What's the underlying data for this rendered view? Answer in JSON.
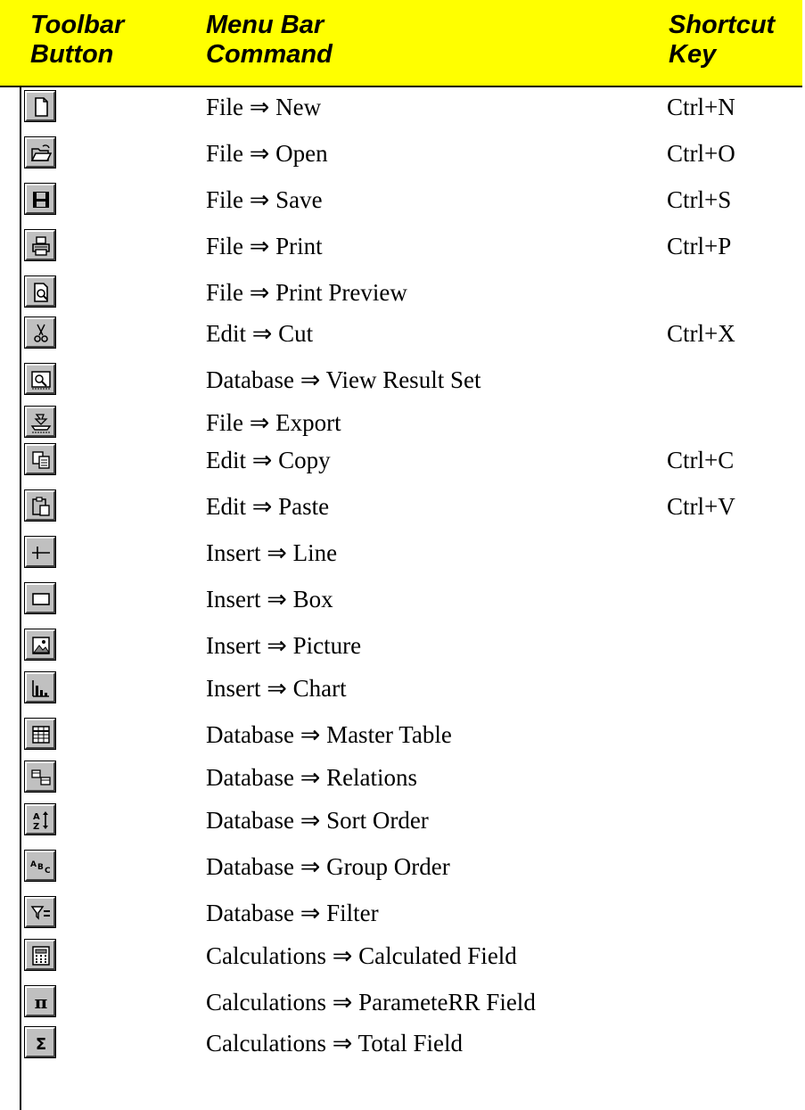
{
  "header": {
    "col1": "Toolbar\nButton",
    "col2": "Menu Bar\nCommand",
    "col3": "Shortcut\nKey"
  },
  "rows": [
    {
      "icon": "new-document-icon",
      "command": "File ⇒ New",
      "shortcut": "Ctrl+N"
    },
    {
      "icon": "open-folder-icon",
      "command": "File ⇒ Open",
      "shortcut": "Ctrl+O"
    },
    {
      "icon": "save-disk-icon",
      "command": "File ⇒ Save",
      "shortcut": "Ctrl+S"
    },
    {
      "icon": "printer-icon",
      "command": "File ⇒ Print",
      "shortcut": "Ctrl+P"
    },
    {
      "icon": "print-preview-icon",
      "command": "File ⇒ Print Preview",
      "shortcut": ""
    },
    {
      "icon": "scissors-icon",
      "command": "Edit ⇒ Cut",
      "shortcut": "Ctrl+X"
    },
    {
      "icon": "view-result-set-icon",
      "command": "Database ⇒ View Result Set",
      "shortcut": ""
    },
    {
      "icon": "export-icon",
      "command": "File ⇒ Export",
      "shortcut": ""
    },
    {
      "icon": "copy-icon",
      "command": "Edit ⇒ Copy",
      "shortcut": "Ctrl+C"
    },
    {
      "icon": "paste-clipboard-icon",
      "command": "Edit ⇒ Paste",
      "shortcut": "Ctrl+V"
    },
    {
      "icon": "line-icon",
      "command": "Insert ⇒ Line",
      "shortcut": ""
    },
    {
      "icon": "box-icon",
      "command": "Insert ⇒ Box",
      "shortcut": ""
    },
    {
      "icon": "picture-icon",
      "command": "Insert ⇒ Picture",
      "shortcut": ""
    },
    {
      "icon": "chart-icon",
      "command": "Insert ⇒ Chart",
      "shortcut": ""
    },
    {
      "icon": "master-table-icon",
      "command": "Database ⇒ Master Table",
      "shortcut": ""
    },
    {
      "icon": "relations-icon",
      "command": "Database ⇒ Relations",
      "shortcut": ""
    },
    {
      "icon": "sort-order-icon",
      "command": "Database ⇒ Sort Order",
      "shortcut": ""
    },
    {
      "icon": "group-order-icon",
      "command": "Database ⇒ Group Order",
      "shortcut": ""
    },
    {
      "icon": "filter-icon",
      "command": "Database ⇒ Filter",
      "shortcut": ""
    },
    {
      "icon": "calculator-icon",
      "command": "Calculations ⇒ Calculated Field",
      "shortcut": ""
    },
    {
      "icon": "pi-icon",
      "command": "Calculations ⇒ ParameteRR Field",
      "shortcut": ""
    },
    {
      "icon": "sigma-icon",
      "command": "Calculations ⇒ Total Field",
      "shortcut": ""
    }
  ]
}
